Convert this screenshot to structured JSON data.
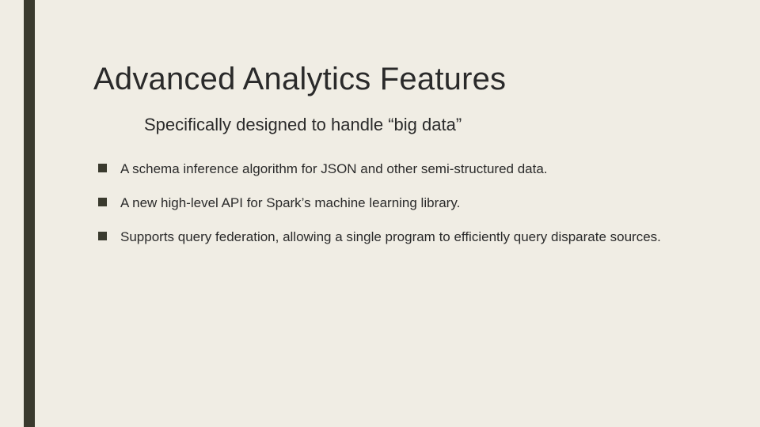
{
  "slide": {
    "title": "Advanced Analytics Features",
    "subtitle": "Specifically designed to handle “big data”",
    "bullets": [
      "A schema inference algorithm for JSON and other semi-structured data.",
      "A new high-level API for Spark’s machine learning library.",
      "Supports query federation, allowing a single program to efficiently query disparate sources."
    ]
  }
}
